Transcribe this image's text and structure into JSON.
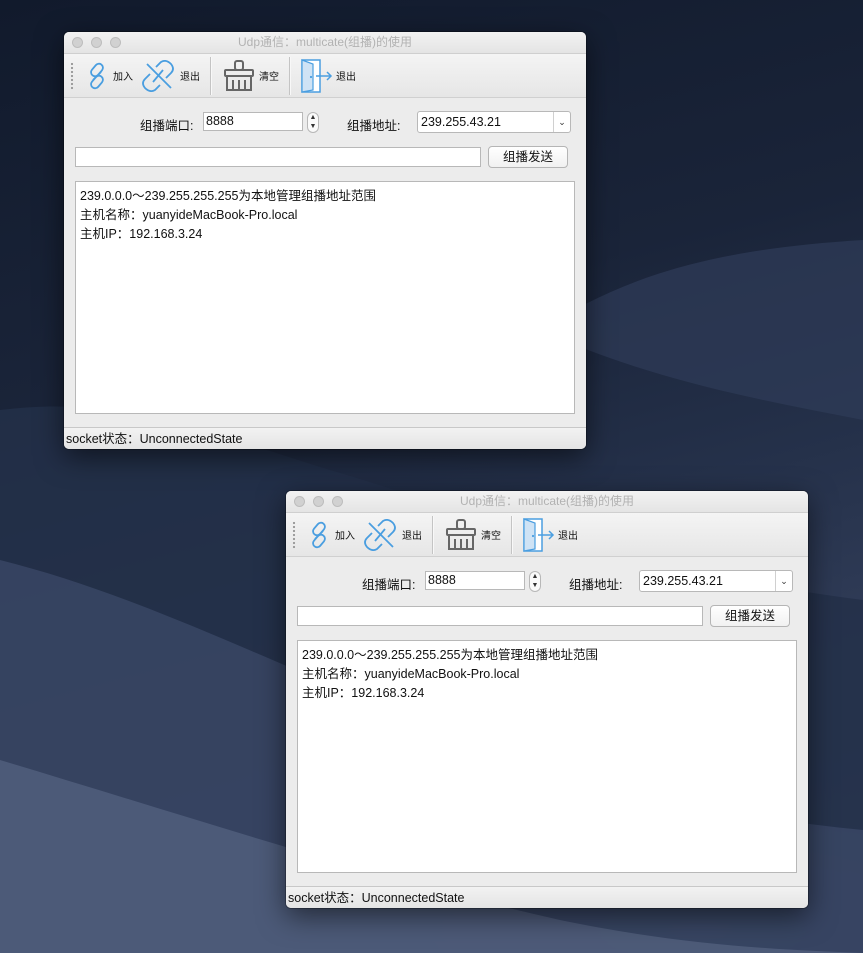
{
  "desktop": {
    "name": "macOS dune wallpaper"
  },
  "windows": [
    {
      "title": "Udp通信：multicate(组播)的使用",
      "toolbar": [
        {
          "label": "加入",
          "icon": "link-icon"
        },
        {
          "label": "退出",
          "icon": "unlink-icon"
        },
        {
          "label": "清空",
          "icon": "broom-icon"
        },
        {
          "label": "退出",
          "icon": "exit-door-icon"
        }
      ],
      "port_label": "组播端口:",
      "port_value": "8888",
      "addr_label": "组播地址:",
      "addr_value": "239.255.43.21",
      "message_value": "",
      "send_label": "组播发送",
      "log": [
        "239.0.0.0～239.255.255.255为本地管理组播地址范围",
        "主机名称：yuanyideMacBook-Pro.local",
        "主机IP：192.168.3.24"
      ],
      "status": "socket状态：UnconnectedState"
    },
    {
      "title": "Udp通信：multicate(组播)的使用",
      "toolbar": [
        {
          "label": "加入",
          "icon": "link-icon"
        },
        {
          "label": "退出",
          "icon": "unlink-icon"
        },
        {
          "label": "清空",
          "icon": "broom-icon"
        },
        {
          "label": "退出",
          "icon": "exit-door-icon"
        }
      ],
      "port_label": "组播端口:",
      "port_value": "8888",
      "addr_label": "组播地址:",
      "addr_value": "239.255.43.21",
      "message_value": "",
      "send_label": "组播发送",
      "log": [
        "239.0.0.0～239.255.255.255为本地管理组播地址范围",
        "主机名称：yuanyideMacBook-Pro.local",
        "主机IP：192.168.3.24"
      ],
      "status": "socket状态：UnconnectedState"
    }
  ]
}
